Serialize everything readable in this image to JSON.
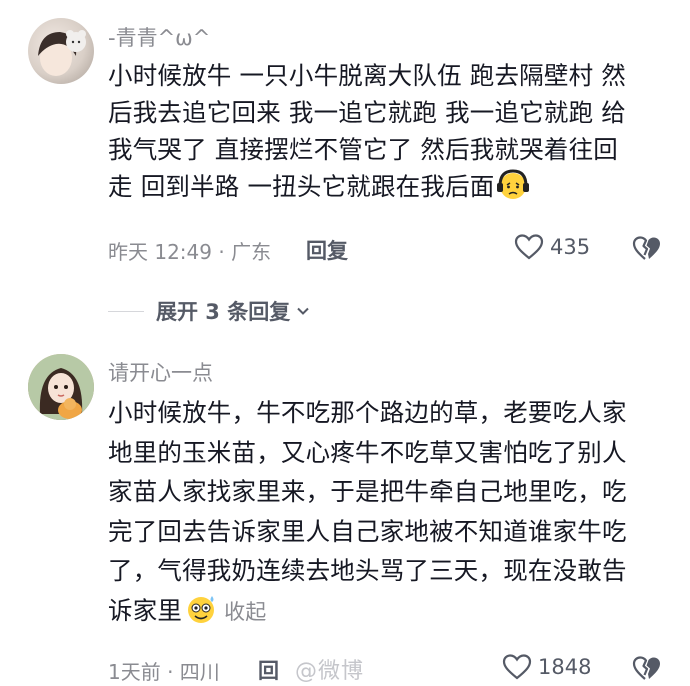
{
  "comments": [
    {
      "username": "-青青^ω^",
      "text_lines": [
        "小时候放牛 一只小牛脱离大队伍 跑去隔壁村 然",
        "后我去追它回来 我一追它就跑 我一追它就跑 给",
        "我气哭了 直接摆烂不管它了 然后我就哭着往回",
        "走 回到半路 一扭头它就跟在我后面"
      ],
      "emoji_icon": "crying-face-with-headphones-icon",
      "meta": "昨天 12:49 · 广东",
      "reply_label": "回复",
      "likes": "435",
      "expand_label": "展开 3 条回复"
    },
    {
      "username": "请开心一点",
      "text_lines": [
        "小时候放牛，牛不吃那个路边的草，老要吃人家",
        "地里的玉米苗，又心疼牛不吃草又害怕吃了别人",
        "家苗人家找家里来，于是把牛牵自己地里吃，吃",
        "完了回去告诉家里人自己家地被不知道谁家牛吃",
        "了，气得我奶连续去地头骂了三天，现在没敢告",
        "诉家里"
      ],
      "emoji_icon": "sweat-smile-face-icon",
      "collapse_label": "收起",
      "meta": "1天前 · 四川",
      "reply_label": "回",
      "likes": "1848"
    }
  ],
  "watermark": "@微博"
}
